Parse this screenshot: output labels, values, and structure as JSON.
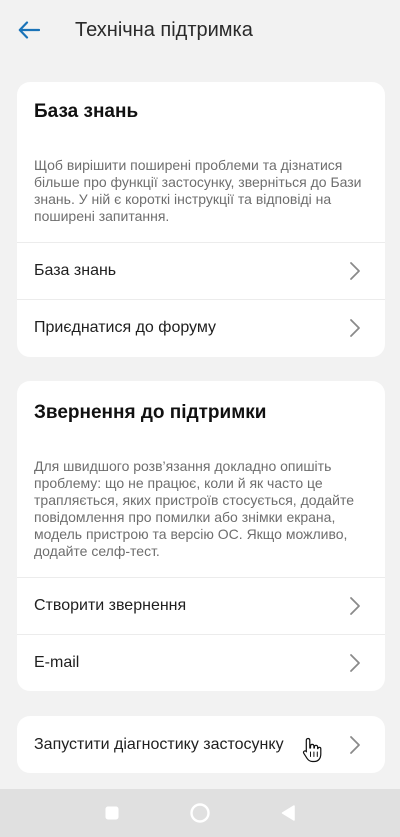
{
  "header": {
    "back_icon": "arrow-left-icon",
    "title": "Технічна підтримка"
  },
  "knowledge": {
    "title": "База знань",
    "description": "Щоб вирішити поширені проблеми та дізнатися більше про функції застосунку, зверніться до Бази знань. У ній є короткі інструкції та відповіді на поширені запитання.",
    "items": [
      {
        "label": "База знань"
      },
      {
        "label": "Приєднатися до форуму"
      }
    ]
  },
  "support": {
    "title": "Звернення до підтримки",
    "description": "Для швидшого розв’язання докладно опишіть проблему: що не працює, коли й як часто це трапляється, яких пристроїв стосується, додайте повідомлення про помилки або знімки екрана, модель пристрою та версію ОС. Якщо можливо, додайте селф-тест.",
    "items": [
      {
        "label": "Створити звернення"
      },
      {
        "label": "E-mail"
      }
    ]
  },
  "diagnostics": {
    "label": "Запустити діагностику застосунку"
  },
  "colors": {
    "accent": "#1a73b8",
    "background": "#f2f2f2",
    "card": "#ffffff",
    "nav_bar": "#e0e0e0"
  },
  "nav_bar": {
    "recents_icon": "square-icon",
    "home_icon": "circle-icon",
    "back_icon": "triangle-back-icon"
  }
}
